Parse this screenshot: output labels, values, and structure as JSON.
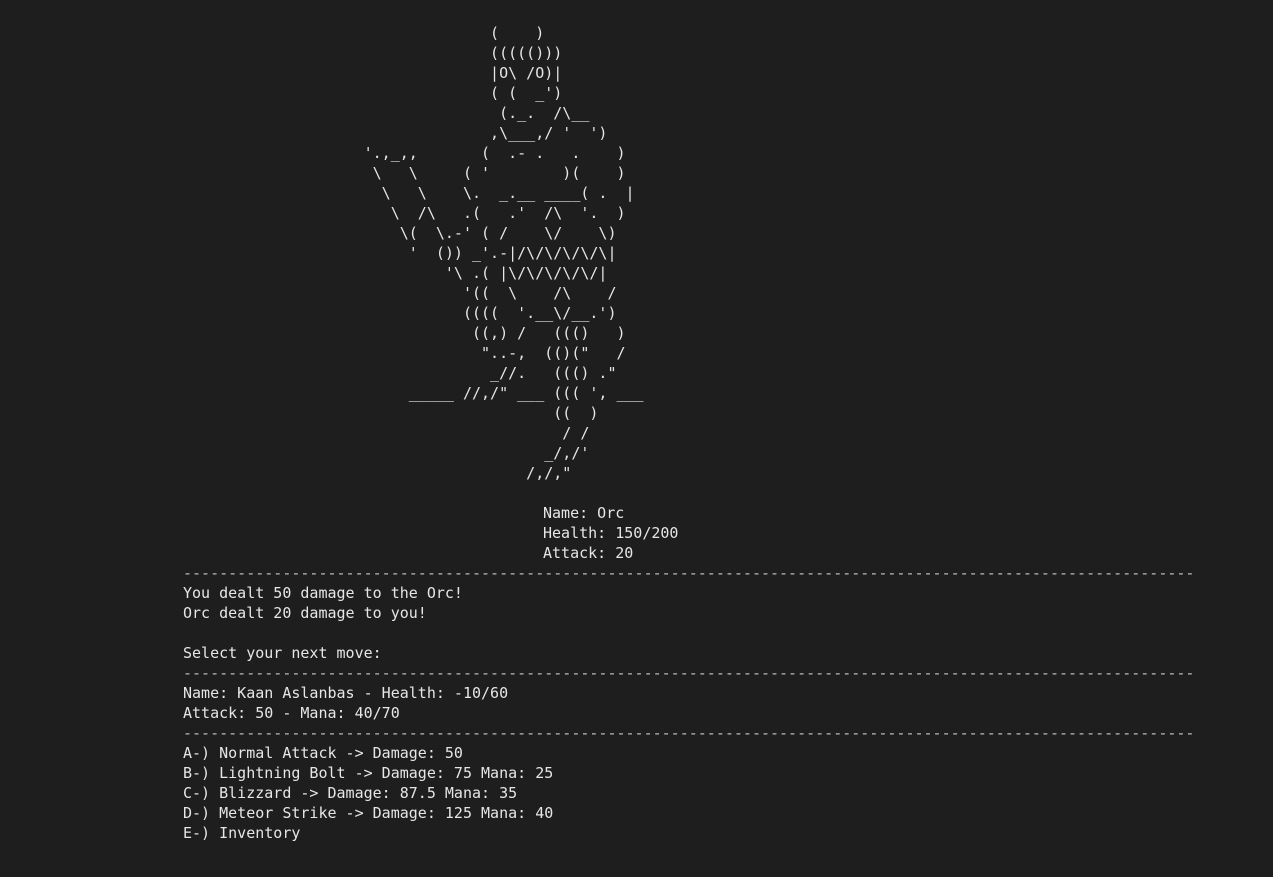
{
  "ascii_art": [
    "                                  (    )",
    "                                  ((((()))",
    "                                  |O\\ /O)|",
    "                                  ( (  _')",
    "                                   (._.  /\\__",
    "                                  ,\\___,/ '  ')",
    "                    '.,_,,       (  .- .   .    )",
    "                     \\   \\     ( '        )(    )",
    "                      \\   \\    \\.  _.__ ____( .  |",
    "                       \\  /\\   .(   .'  /\\  '.  )",
    "                        \\(  \\.-' ( /    \\/    \\)",
    "                         '  ()) _'.-|/\\/\\/\\/\\/\\|",
    "                             '\\ .( |\\/\\/\\/\\/\\/|",
    "                               '((  \\    /\\    /",
    "                               ((((  '.__\\/__.')",
    "                                ((,) /   ((()   )",
    "                                 \"..-,  (()(\"   /",
    "                                  _//.   ((() .\"",
    "                         _____ //,/\" ___ ((( ', ___",
    "                                         ((  )",
    "                                          / /",
    "                                        _/,/'",
    "                                      /,/,\""
  ],
  "enemy": {
    "name_line": "Name: Orc",
    "health_line": "Health: 150/200",
    "attack_line": "Attack: 20"
  },
  "separator": "----------------------------------------------------------------------------------------------------------------",
  "messages": {
    "player_hit": "You dealt 50 damage to the Orc!",
    "enemy_hit": "Orc dealt 20 damage to you!",
    "prompt": "Select your next move:"
  },
  "player": {
    "line1": "Name: Kaan Aslanbas - Health: -10/60",
    "line2": "Attack: 50 - Mana: 40/70"
  },
  "moves": [
    "A-) Normal Attack -> Damage: 50",
    "B-) Lightning Bolt -> Damage: 75 Mana: 25",
    "C-) Blizzard -> Damage: 87.5 Mana: 35",
    "D-) Meteor Strike -> Damage: 125 Mana: 40",
    "E-) Inventory"
  ]
}
